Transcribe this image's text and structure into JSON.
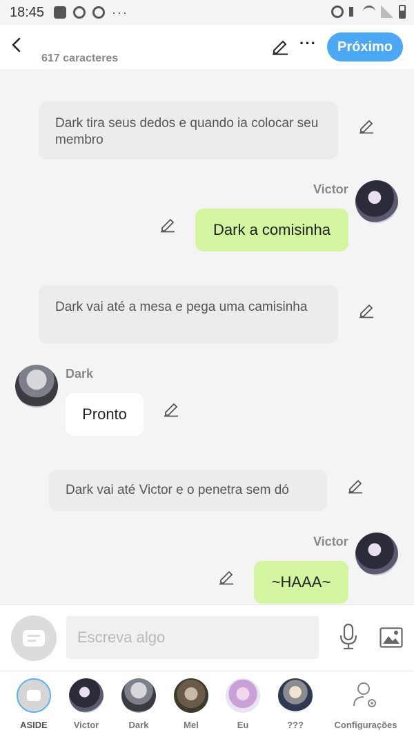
{
  "status_bar": {
    "time": "18:45",
    "dots": "···"
  },
  "header": {
    "back_icon": "‹",
    "char_count": "617 caracteres",
    "more_label": "···",
    "next_label": "Próximo"
  },
  "messages": [
    {
      "type": "narration",
      "text": "Dark tira seus dedos e quando ia colocar seu membro"
    },
    {
      "type": "message",
      "speaker": "Victor",
      "text": "Dark a comisinha",
      "side": "right"
    },
    {
      "type": "narration",
      "text": "Dark vai até a mesa e pega uma camisinha"
    },
    {
      "type": "message",
      "speaker": "Dark",
      "text": "Pronto",
      "side": "left"
    },
    {
      "type": "narration",
      "text": "Dark vai até Victor e o penetra sem dó"
    },
    {
      "type": "message",
      "speaker": "Victor",
      "text": "~HAAA~",
      "side": "right"
    }
  ],
  "composer": {
    "placeholder": "Escreva algo"
  },
  "characters": [
    {
      "label": "ASIDE"
    },
    {
      "label": "Victor"
    },
    {
      "label": "Dark"
    },
    {
      "label": "Mel"
    },
    {
      "label": "Eu"
    },
    {
      "label": "???"
    },
    {
      "label": "Configurações"
    }
  ],
  "colors": {
    "accent": "#4aa8f4",
    "own_bubble": "#d4f5a0",
    "narration_bubble": "#ececec",
    "background": "#f4f4f4"
  }
}
